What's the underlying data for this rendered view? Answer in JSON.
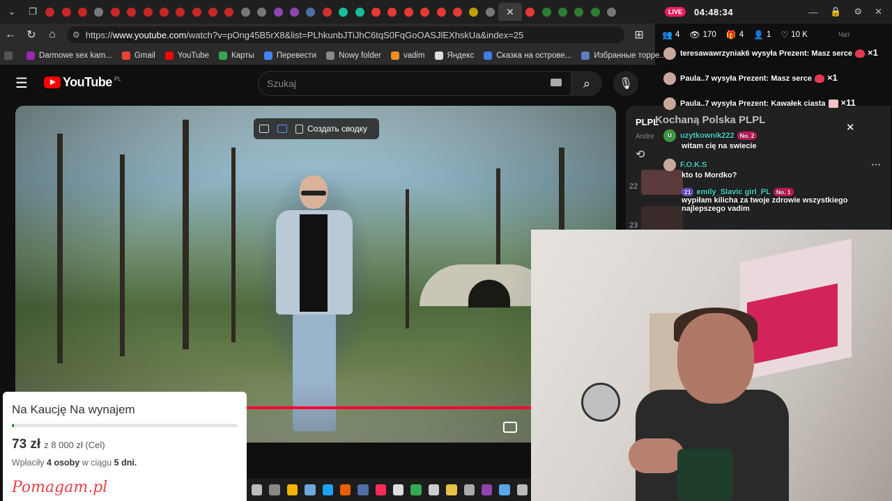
{
  "browser": {
    "tabs": [
      {
        "color": "#c62828"
      },
      {
        "color": "#c62828"
      },
      {
        "color": "#c62828"
      },
      {
        "color": "#777777"
      },
      {
        "color": "#c62828"
      },
      {
        "color": "#c62828"
      },
      {
        "color": "#c62828"
      },
      {
        "color": "#c62828"
      },
      {
        "color": "#c62828"
      },
      {
        "color": "#c62828"
      },
      {
        "color": "#c62828"
      },
      {
        "color": "#c62828"
      },
      {
        "color": "#777777"
      },
      {
        "color": "#777777"
      },
      {
        "color": "#8e44ad"
      },
      {
        "color": "#8e44ad"
      },
      {
        "color": "#4a6fa5"
      },
      {
        "color": "#d32f2f"
      },
      {
        "color": "#1abc9c"
      },
      {
        "color": "#1abc9c"
      },
      {
        "color": "#e53935"
      },
      {
        "color": "#e53935"
      },
      {
        "color": "#e53935"
      },
      {
        "color": "#e53935"
      },
      {
        "color": "#e53935"
      },
      {
        "color": "#e53935"
      },
      {
        "color": "#c0a000"
      },
      {
        "color": "#777777"
      }
    ],
    "tabs_after": [
      {
        "color": "#e53935"
      },
      {
        "color": "#2e7d32"
      },
      {
        "color": "#2e7d32"
      },
      {
        "color": "#2e7d32"
      },
      {
        "color": "#2e7d32"
      },
      {
        "color": "#777777"
      }
    ],
    "url_prefix": "https://",
    "url_host": "www.youtube.com",
    "url_path": "/watch?v=pOng45B5rX8&list=PLhkunbJTiJhC6tqS0FqGoOASJlEXhskUa&index=25",
    "bookmarks": [
      {
        "label": "Darmowe sex kam...",
        "color": "#9c27b0"
      },
      {
        "label": "Gmail",
        "color": "#ea4335"
      },
      {
        "label": "YouTube",
        "color": "#ff0000"
      },
      {
        "label": "Карты",
        "color": "#34a853"
      },
      {
        "label": "Перевести",
        "color": "#4285f4"
      },
      {
        "label": "Nowy folder",
        "color": "#888888"
      },
      {
        "label": "vadim",
        "color": "#f28b22"
      },
      {
        "label": "Яндекс",
        "color": "#dddddd"
      },
      {
        "label": "Сказка на острове...",
        "color": "#3f7ee8"
      },
      {
        "label": "Избранные торре...",
        "color": "#5f7dbd"
      }
    ]
  },
  "youtube": {
    "logo_text": "YouTube",
    "country_code": "PL",
    "search_placeholder": "Szukaj",
    "summary_button": "Создать сводку"
  },
  "playlist": {
    "title": "PLPL",
    "author": "Andre",
    "index_22": "22",
    "index_23": "23"
  },
  "stream": {
    "live": "LIVE",
    "clock": "04:48:34",
    "stats": {
      "guests": "4",
      "viewers": "170",
      "gifts": "4",
      "follows": "1",
      "likes": "10 K",
      "chat": "Чат"
    },
    "overlay_title": "Kochaną Polska PLPL",
    "messages": [
      {
        "user": "teresawawrzyniak6",
        "text": "wysyła Prezent: Masz serce",
        "count": "×1",
        "gift": "heart"
      },
      {
        "user": "Paula..7",
        "text": "wysyła Prezent: Masz serce",
        "count": "×1",
        "gift": "heart"
      },
      {
        "user": "Paula..7",
        "text": "wysyła Prezent: Kawałek ciasta",
        "count": "×11",
        "gift": "cake"
      },
      {
        "user": "uzytkownik222",
        "badge": "No. 2",
        "avatar_letter": "u",
        "body": "witam cię na swiecie"
      },
      {
        "user": "F.O.K.S",
        "body": "kto to Mordko?"
      },
      {
        "user": "emily_Slavic girl_PL",
        "level": "21",
        "badge": "No. 1",
        "body": "wypiłam kilicha za twoje zdrowie wszystkiego najlepszego vadim"
      }
    ]
  },
  "donation": {
    "title": "Na Kaucję Na wynajem",
    "raised": "73 zł",
    "goal_text": "z 8 000 zł (Cel)",
    "progress_fraction": 0.009,
    "supporters_prefix": "Wpłaciły",
    "supporters": "4 osoby",
    "supporters_mid": "w ciągu",
    "days": "5 dni.",
    "logo": "Pomagam.pl"
  },
  "taskbar": {
    "icons": [
      "#bbbbbb",
      "#888888",
      "#f4b400",
      "#6fa8dc",
      "#1da1f2",
      "#e66000",
      "#4f6fa5",
      "#ff2d55",
      "#dddddd",
      "#34a853",
      "#cccccc",
      "#e8c24a",
      "#aaaaaa",
      "#8e44ad",
      "#5aa7e8",
      "#bbbbbb"
    ]
  }
}
